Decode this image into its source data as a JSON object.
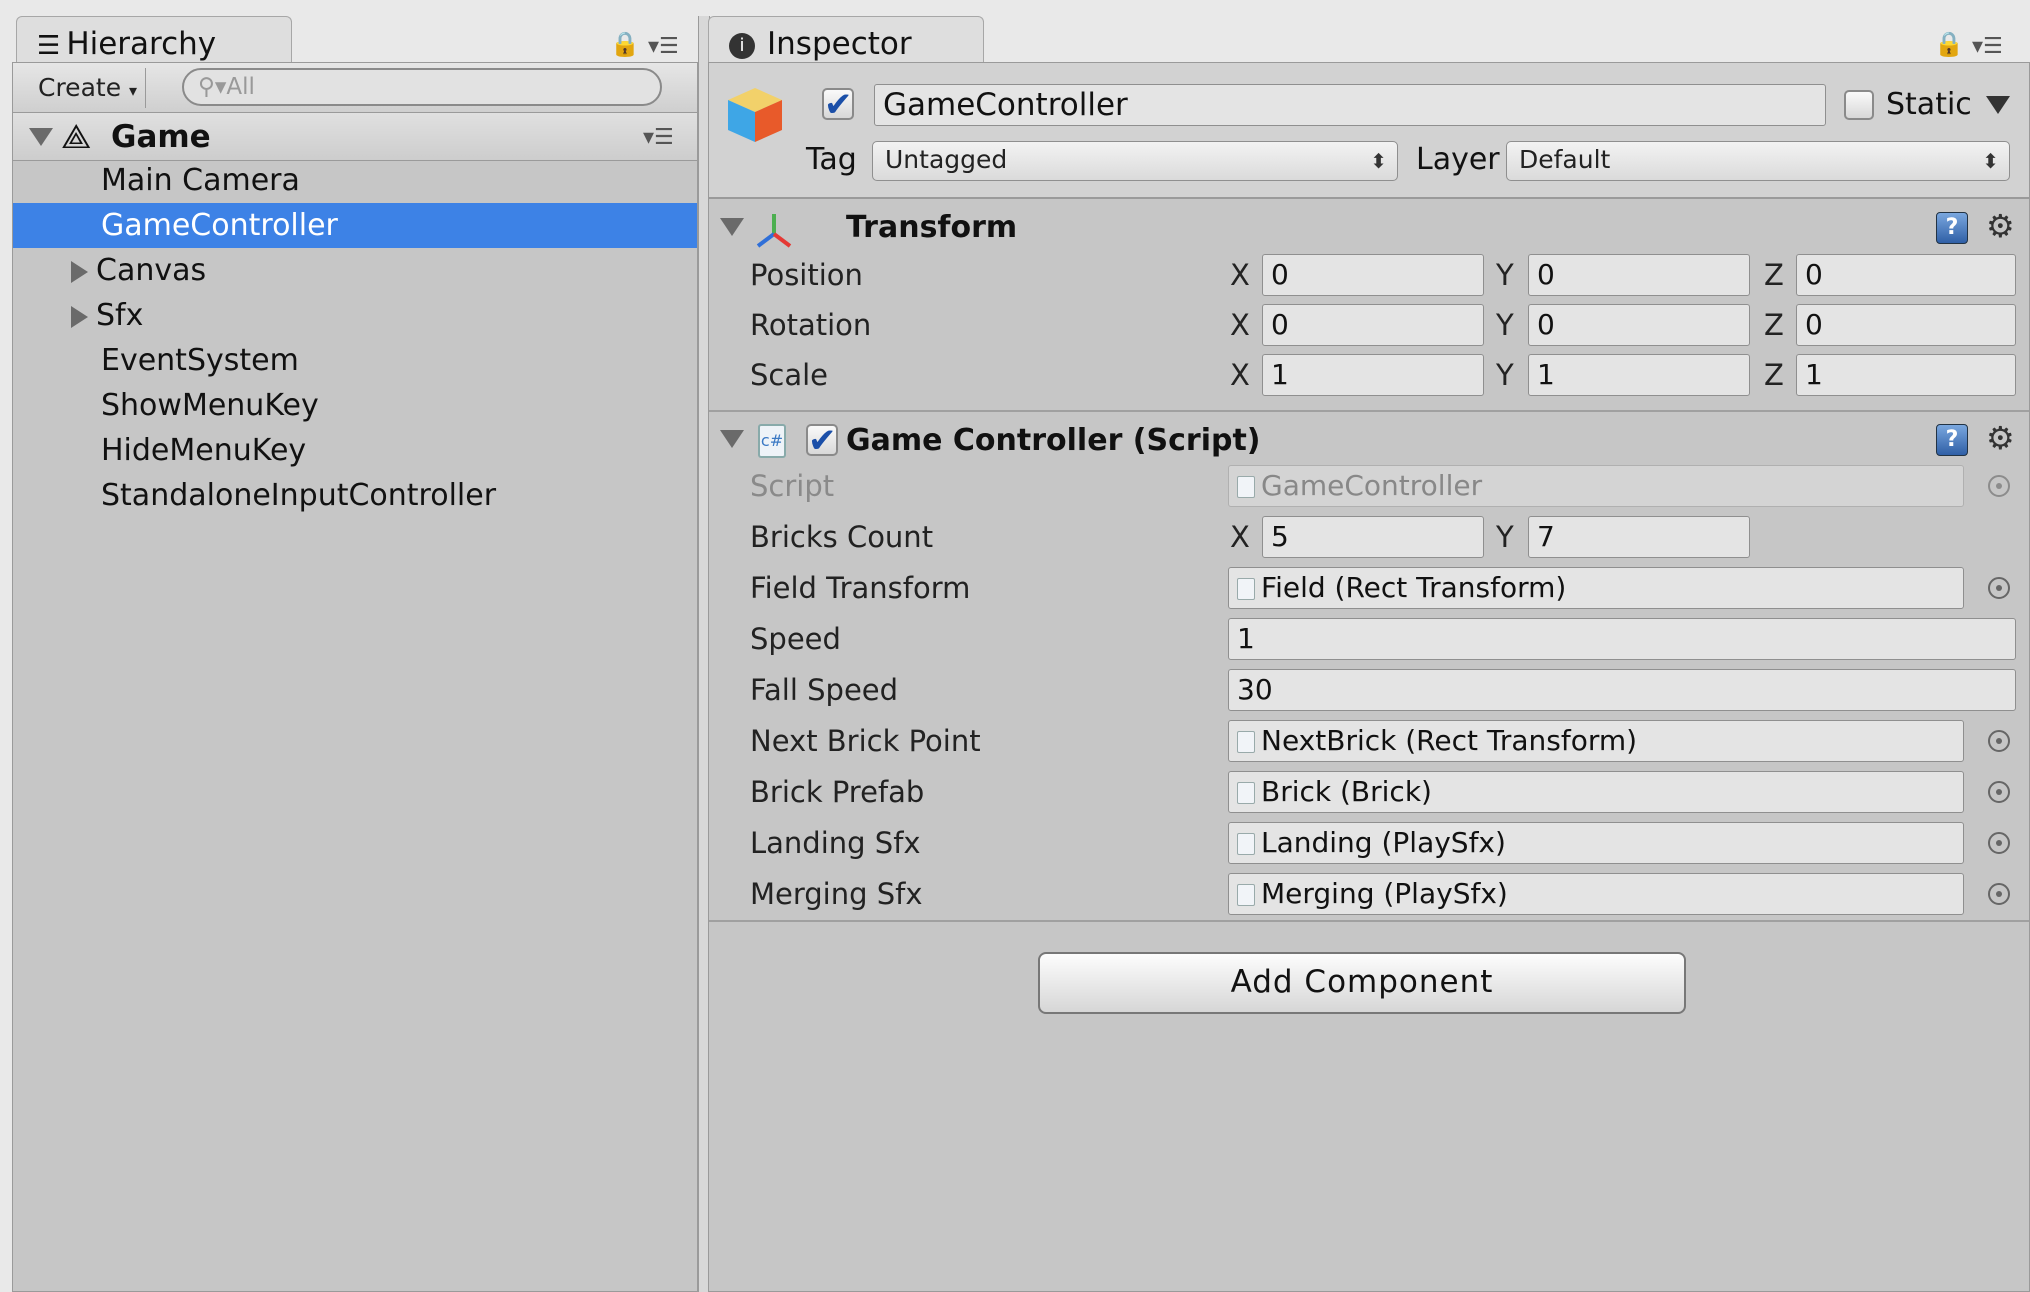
{
  "hierarchy": {
    "tab_title": "Hierarchy",
    "create_label": "Create",
    "search_placeholder": "All",
    "scene_name": "Game",
    "items": [
      {
        "label": "Main Camera"
      },
      {
        "label": "GameController",
        "selected": true
      },
      {
        "label": "Canvas",
        "expandable": true
      },
      {
        "label": "Sfx",
        "expandable": true
      },
      {
        "label": "EventSystem"
      },
      {
        "label": "ShowMenuKey"
      },
      {
        "label": "HideMenuKey"
      },
      {
        "label": "StandaloneInputController"
      }
    ]
  },
  "inspector": {
    "tab_title": "Inspector",
    "object_name": "GameController",
    "active_checked": true,
    "static_label": "Static",
    "tag_label": "Tag",
    "tag_value": "Untagged",
    "layer_label": "Layer",
    "layer_value": "Default",
    "transform": {
      "title": "Transform",
      "position_label": "Position",
      "rotation_label": "Rotation",
      "scale_label": "Scale",
      "position": {
        "x": "0",
        "y": "0",
        "z": "0"
      },
      "rotation": {
        "x": "0",
        "y": "0",
        "z": "0"
      },
      "scale": {
        "x": "1",
        "y": "1",
        "z": "1"
      },
      "axis_x": "X",
      "axis_y": "Y",
      "axis_z": "Z"
    },
    "script_component": {
      "title": "Game Controller (Script)",
      "script_label": "Script",
      "script_value": "GameController",
      "bricks_count_label": "Bricks Count",
      "bricks_count": {
        "x": "5",
        "y": "7"
      },
      "field_transform_label": "Field Transform",
      "field_transform_value": "Field (Rect Transform)",
      "speed_label": "Speed",
      "speed_value": "1",
      "fall_speed_label": "Fall Speed",
      "fall_speed_value": "30",
      "next_brick_point_label": "Next Brick Point",
      "next_brick_point_value": "NextBrick (Rect Transform)",
      "brick_prefab_label": "Brick Prefab",
      "brick_prefab_value": "Brick (Brick)",
      "landing_sfx_label": "Landing Sfx",
      "landing_sfx_value": "Landing (PlaySfx)",
      "merging_sfx_label": "Merging Sfx",
      "merging_sfx_value": "Merging (PlaySfx)"
    },
    "add_component_label": "Add Component"
  },
  "colors": {
    "selection": "#3d82e6",
    "panel_bg": "#c6c6c6"
  }
}
